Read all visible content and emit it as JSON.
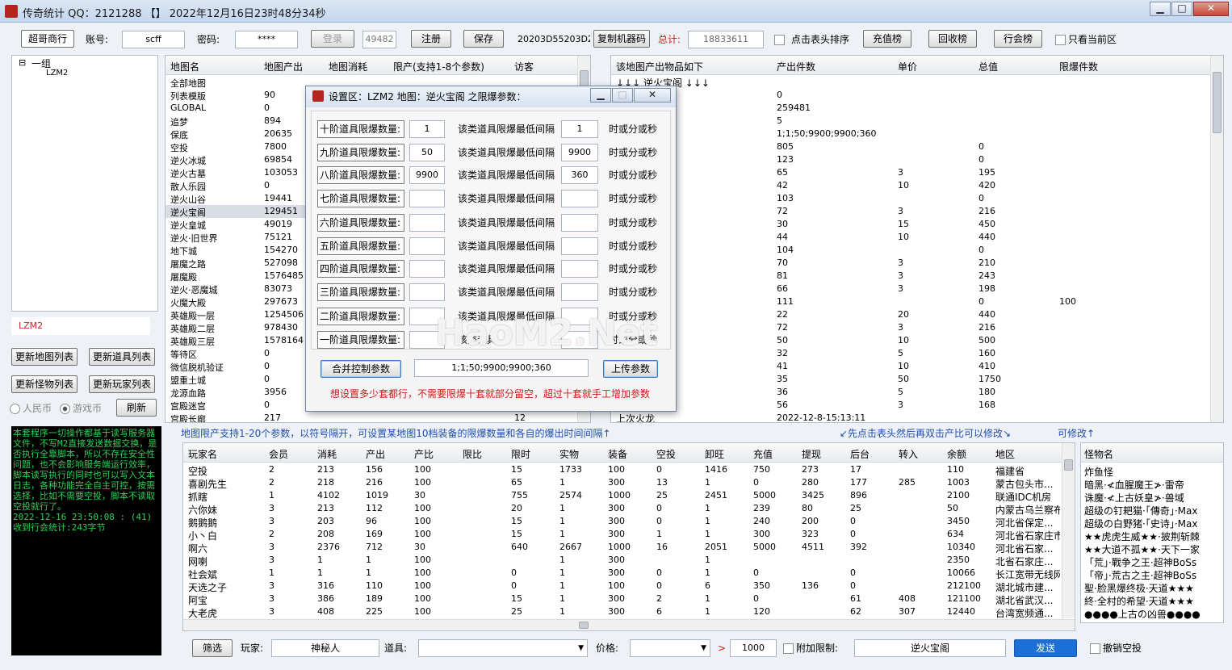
{
  "window": {
    "title": "传奇统计 QQ：2121288 【】 2022年12月16日23时48分34秒",
    "minimize": "▁",
    "maximize": "□",
    "close": "✕"
  },
  "toolbar": {
    "tab_label": "超哥商行",
    "account_label": "账号:",
    "account_value": "scff",
    "password_label": "密码:",
    "password_value": "****",
    "login": "登录",
    "port_value": "49482",
    "register": "注册",
    "save": "保存",
    "machine_code": "20203D55203D2",
    "copy_machine": "复制机器码",
    "total_label": "总计:",
    "total_value": "18833611",
    "sort_label": "点击表头排序",
    "recharge_rank": "充值榜",
    "recycle_rank": "回收榜",
    "guild_rank": "行会榜",
    "current_zone_only": "只看当前区"
  },
  "tree": {
    "root": "一组",
    "child": "LZM2",
    "expander": "⊟"
  },
  "left": {
    "server_input": "LZM2",
    "btn_update_map": "更新地图列表",
    "btn_update_item": "更新道具列表",
    "btn_update_monster": "更新怪物列表",
    "btn_update_player": "更新玩家列表",
    "radio_rmb": "人民币",
    "radio_game": "游戏币",
    "refresh": "刷新"
  },
  "map_grid": {
    "headers": [
      "地图名",
      "地图产出",
      "地图消耗",
      "限产(支持1-8个参数)",
      "访客"
    ],
    "rows": [
      [
        "全部地图",
        ""
      ],
      [
        "列表模版",
        "90"
      ],
      [
        "GLOBAL",
        "0"
      ],
      [
        "追梦",
        "894"
      ],
      [
        "保底",
        "20635"
      ],
      [
        "空投",
        "7800"
      ],
      [
        "逆火冰城",
        "69854"
      ],
      [
        "逆火古墓",
        "103053"
      ],
      [
        "散人乐园",
        "0"
      ],
      [
        "逆火山谷",
        "19441"
      ],
      [
        "逆火宝阁",
        "129451"
      ],
      [
        "逆火皇城",
        "49019"
      ],
      [
        "逆火·旧世界",
        "75121"
      ],
      [
        "地下城",
        "154270"
      ],
      [
        "屠魔之路",
        "527098"
      ],
      [
        "屠魔殿",
        "1576485"
      ],
      [
        "逆火·恶魔城",
        "83073"
      ],
      [
        "火魔大殿",
        "297673"
      ],
      [
        "英雄殿一层",
        "1254506"
      ],
      [
        "英雄殿二层",
        "978430"
      ],
      [
        "英雄殿三层",
        "1578164"
      ],
      [
        "等待区",
        "0"
      ],
      [
        "微信脱机验证",
        "0"
      ],
      [
        "盟重土城",
        "0"
      ],
      [
        "龙源血路",
        "3956"
      ],
      [
        "宫殿迷宫",
        "0"
      ],
      [
        "宫殿长廊",
        "217",
        "12"
      ]
    ]
  },
  "item_grid": {
    "headers": [
      "该地图产出物品如下",
      "产出件数",
      "单价",
      "总值",
      "限爆件数"
    ],
    "first_row": "↓↓↓ 逆火宝阁 ↓↓↓",
    "rows": [
      [
        "",
        "0",
        "",
        "",
        ""
      ],
      [
        "",
        "259481",
        "",
        "",
        ""
      ],
      [
        "",
        "5",
        "",
        "",
        ""
      ],
      [
        "",
        "1;1;50;9900;9900;360",
        "",
        "",
        ""
      ],
      [
        "",
        "805",
        "",
        "0",
        ""
      ],
      [
        "",
        "123",
        "",
        "0",
        ""
      ],
      [
        "",
        "65",
        "3",
        "195",
        ""
      ],
      [
        "",
        "42",
        "10",
        "420",
        ""
      ],
      [
        "",
        "103",
        "",
        "0",
        ""
      ],
      [
        "",
        "72",
        "3",
        "216",
        ""
      ],
      [
        "",
        "30",
        "15",
        "450",
        ""
      ],
      [
        "",
        "44",
        "10",
        "440",
        ""
      ],
      [
        "",
        "104",
        "",
        "0",
        ""
      ],
      [
        "",
        "70",
        "3",
        "210",
        ""
      ],
      [
        "",
        "81",
        "3",
        "243",
        ""
      ],
      [
        "",
        "66",
        "3",
        "198",
        ""
      ],
      [
        "",
        "111",
        "",
        "0",
        "100"
      ],
      [
        "",
        "22",
        "20",
        "440",
        ""
      ],
      [
        "",
        "72",
        "3",
        "216",
        ""
      ],
      [
        "",
        "50",
        "10",
        "500",
        ""
      ],
      [
        "",
        "32",
        "5",
        "160",
        ""
      ],
      [
        "",
        "41",
        "10",
        "410",
        ""
      ],
      [
        "",
        "35",
        "50",
        "1750",
        ""
      ],
      [
        "",
        "36",
        "5",
        "180",
        ""
      ],
      [
        "",
        "56",
        "3",
        "168",
        ""
      ],
      [
        "",
        "2022-12-8-15:13:11",
        "",
        "",
        ""
      ]
    ],
    "last_name": "上次火龙"
  },
  "dialog": {
    "title": "设置区：LZM2 地图：逆火宝阁 之限爆参数：",
    "rows": [
      {
        "label": "十阶道具限爆数量:",
        "count": "1",
        "text": "该类道具限爆最低间隔",
        "interval": "1",
        "unit": "时或分或秒"
      },
      {
        "label": "九阶道具限爆数量:",
        "count": "50",
        "text": "该类道具限爆最低间隔",
        "interval": "9900",
        "unit": "时或分或秒"
      },
      {
        "label": "八阶道具限爆数量:",
        "count": "9900",
        "text": "该类道具限爆最低间隔",
        "interval": "360",
        "unit": "时或分或秒"
      },
      {
        "label": "七阶道具限爆数量:",
        "count": "",
        "text": "该类道具限爆最低间隔",
        "interval": "",
        "unit": "时或分或秒"
      },
      {
        "label": "六阶道具限爆数量:",
        "count": "",
        "text": "该类道具限爆最低间隔",
        "interval": "",
        "unit": "时或分或秒"
      },
      {
        "label": "五阶道具限爆数量:",
        "count": "",
        "text": "该类道具限爆最低间隔",
        "interval": "",
        "unit": "时或分或秒"
      },
      {
        "label": "四阶道具限爆数量:",
        "count": "",
        "text": "该类道具限爆最低间隔",
        "interval": "",
        "unit": "时或分或秒"
      },
      {
        "label": "三阶道具限爆数量:",
        "count": "",
        "text": "该类道具限爆最低间隔",
        "interval": "",
        "unit": "时或分或秒"
      },
      {
        "label": "二阶道具限爆数量:",
        "count": "",
        "text": "该类道具限爆最低间隔",
        "interval": "",
        "unit": "时或分或秒"
      },
      {
        "label": "一阶道具限爆数量:",
        "count": "",
        "text": "该类道具",
        "interval": "",
        "unit": "时或分或秒"
      }
    ],
    "merge_button": "合并控制参数",
    "merged_value": "1;1;50;9900;9900;360",
    "upload_button": "上传参数",
    "hint": "想设置多少套都行，不需要限爆十套就部分留空，超过十套就手工增加参数",
    "watermark": "HaoM2.Net"
  },
  "info_bar": {
    "left": "地图限产支持1-20个参数，以符号隔开，可设置某地图10档装备的限爆数量和各自的爆出时间间隔↑",
    "mid": "↙先点击表头然后再双击产比可以修改↘",
    "right": "可修改↑"
  },
  "log": "本套程序一切操作都基于读写服务器文件，不写M2直接发送数据交换，是否执行全靠脚本，所以不存在安全性问题，也不会影响服务端运行效率，脚本读写执行的同时也可以写入文本日志，各种功能完全自主可控，按需选择，比如不需要空投，脚本不读取空投就行了。\n2022-12-16 23:50:08 : (41)收到行会统计:243字节",
  "player_grid": {
    "headers": [
      "玩家名",
      "会员",
      "消耗",
      "产出",
      "产比",
      "限比",
      "限时",
      "实物",
      "装备",
      "空投",
      "卸旺",
      "充值",
      "提现",
      "后台",
      "转入",
      "余额",
      "地区"
    ],
    "rows": [
      [
        "空投",
        "2",
        "213",
        "156",
        "100",
        "",
        "15",
        "1733",
        "100",
        "0",
        "1416",
        "750",
        "273",
        "17",
        "",
        "110",
        "福建省"
      ],
      [
        "喜剧先生",
        "2",
        "218",
        "216",
        "100",
        "",
        "65",
        "1",
        "300",
        "13",
        "1",
        "0",
        "280",
        "177",
        "285",
        "1003",
        "蒙古包头市..."
      ],
      [
        "抓瞎",
        "1",
        "4102",
        "1019",
        "30",
        "",
        "755",
        "2574",
        "1000",
        "25",
        "2451",
        "5000",
        "3425",
        "896",
        "",
        "2100",
        "联通IDC机房"
      ],
      [
        "六你妹",
        "3",
        "213",
        "112",
        "100",
        "",
        "20",
        "1",
        "300",
        "0",
        "1",
        "239",
        "80",
        "25",
        "",
        "50",
        "内蒙古乌兰察布"
      ],
      [
        "鹅鹅鹅",
        "3",
        "203",
        "96",
        "100",
        "",
        "15",
        "1",
        "300",
        "0",
        "1",
        "240",
        "200",
        "0",
        "",
        "3450",
        "河北省保定..."
      ],
      [
        "小丶白",
        "2",
        "208",
        "169",
        "100",
        "",
        "15",
        "1",
        "300",
        "1",
        "1",
        "300",
        "323",
        "0",
        "",
        "634",
        "河北省石家庄市"
      ],
      [
        "啊六",
        "3",
        "2376",
        "712",
        "30",
        "",
        "640",
        "2667",
        "1000",
        "16",
        "2051",
        "5000",
        "4511",
        "392",
        "",
        "10340",
        "河北省石家..."
      ],
      [
        "网喇",
        "3",
        "1",
        "1",
        "100",
        "",
        "",
        "1",
        "300",
        "",
        "1",
        "",
        "",
        "",
        "",
        "2350",
        "北省石家庄..."
      ],
      [
        "社会斌",
        "1",
        "1",
        "1",
        "100",
        "",
        "0",
        "1",
        "300",
        "0",
        "1",
        "0",
        "",
        "0",
        "",
        "10066",
        "长江宽带无线网"
      ],
      [
        "天选之子",
        "3",
        "316",
        "110",
        "100",
        "",
        "0",
        "1",
        "100",
        "0",
        "6",
        "350",
        "136",
        "0",
        "",
        "212100",
        "湖北城市建..."
      ],
      [
        "阿宝",
        "3",
        "386",
        "189",
        "100",
        "",
        "15",
        "1",
        "300",
        "2",
        "1",
        "0",
        "",
        "61",
        "408",
        "121100",
        "湖北省武汉..."
      ],
      [
        "大老虎",
        "3",
        "408",
        "225",
        "100",
        "",
        "25",
        "1",
        "300",
        "6",
        "1",
        "120",
        "",
        "62",
        "307",
        "12440",
        "台湾宽频通..."
      ]
    ]
  },
  "monster_grid": {
    "header": "怪物名",
    "rows": [
      "炸鱼怪",
      "暗黑·≮血腥魔王≯·雷帝",
      "诛魔·≮上古妖皇≯·兽域",
      "超级の钉耙猫·「傳奇」·Max",
      "超级の白野猪·「史诗」·Max",
      "★★虎虎生威★★·披荆斩棘",
      "★★大道不孤★★·天下一家",
      "「荒」·戰争之王·超神BoSs",
      "「帝」·荒古之主·超神BoSs",
      "聖·脸黑爆终极·天道★★★",
      "終·全村的希望·天道★★★",
      "●●●●上古の凶兽●●●●"
    ]
  },
  "bottom": {
    "filter": "筛选",
    "player_label": "玩家:",
    "player_value": "神秘人",
    "item_label": "道具:",
    "item_value": "",
    "price_label": "价格:",
    "price_value": "",
    "arrow": ">",
    "threshold": "1000",
    "extra_limit": "附加限制:",
    "map_value": "逆火宝阁",
    "send": "发送",
    "cancel_airdrop": "撤销空投"
  },
  "colors": {
    "accent_blue": "#1b6fd6",
    "red": "#cc1b1b",
    "log_green": "#2fd05a"
  }
}
